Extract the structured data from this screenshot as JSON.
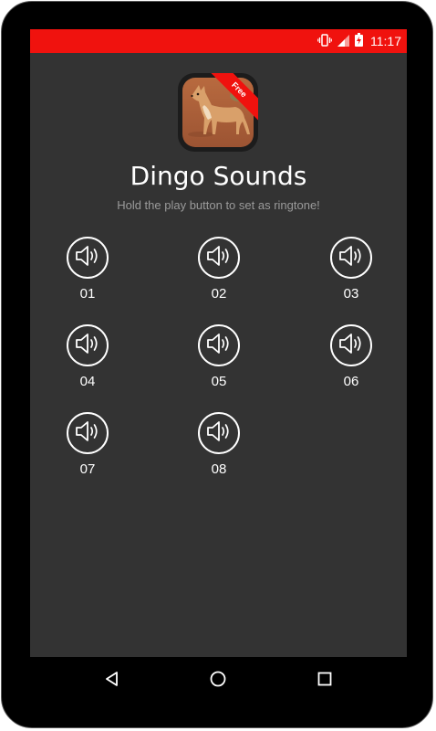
{
  "status_bar": {
    "time": "11:17",
    "icons": [
      "vibrate-icon",
      "signal-icon",
      "battery-charging-icon"
    ],
    "color": "#f0120e"
  },
  "app": {
    "icon_badge": "Free",
    "title": "Dingo Sounds",
    "subtitle": "Hold the play button to set as ringtone!"
  },
  "sounds": [
    {
      "label": "01",
      "icon": "speaker-icon"
    },
    {
      "label": "02",
      "icon": "speaker-icon"
    },
    {
      "label": "03",
      "icon": "speaker-icon"
    },
    {
      "label": "04",
      "icon": "speaker-icon"
    },
    {
      "label": "05",
      "icon": "speaker-icon"
    },
    {
      "label": "06",
      "icon": "speaker-icon"
    },
    {
      "label": "07",
      "icon": "speaker-icon"
    },
    {
      "label": "08",
      "icon": "speaker-icon"
    }
  ],
  "nav_bar": {
    "icons": [
      "back-icon",
      "home-icon",
      "recents-icon"
    ]
  },
  "colors": {
    "accent": "#f0120e",
    "background": "#333333"
  }
}
